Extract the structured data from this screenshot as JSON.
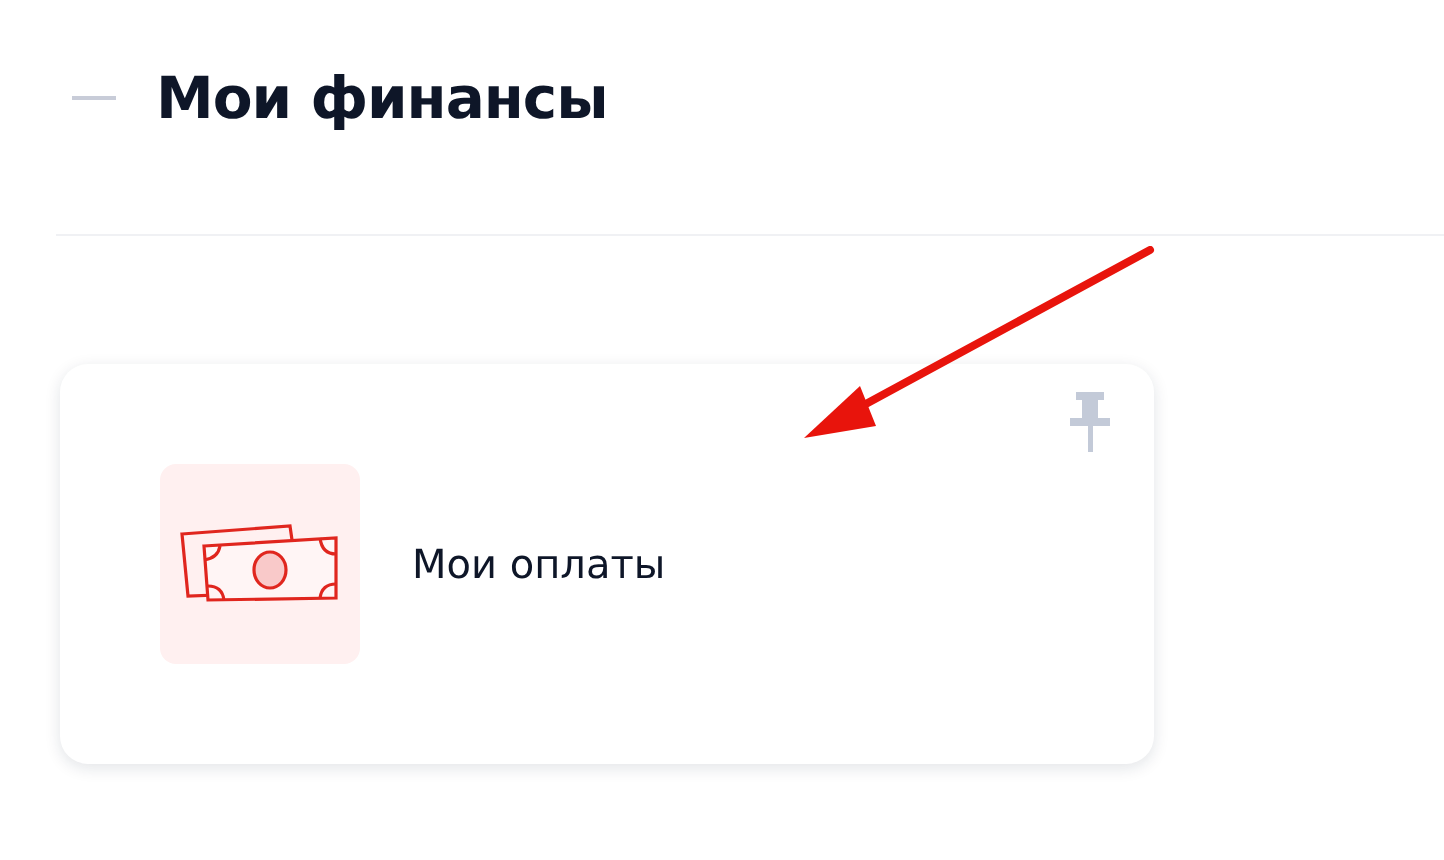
{
  "section": {
    "title": "Мои финансы"
  },
  "cards": [
    {
      "label": "Мои оплаты"
    }
  ]
}
